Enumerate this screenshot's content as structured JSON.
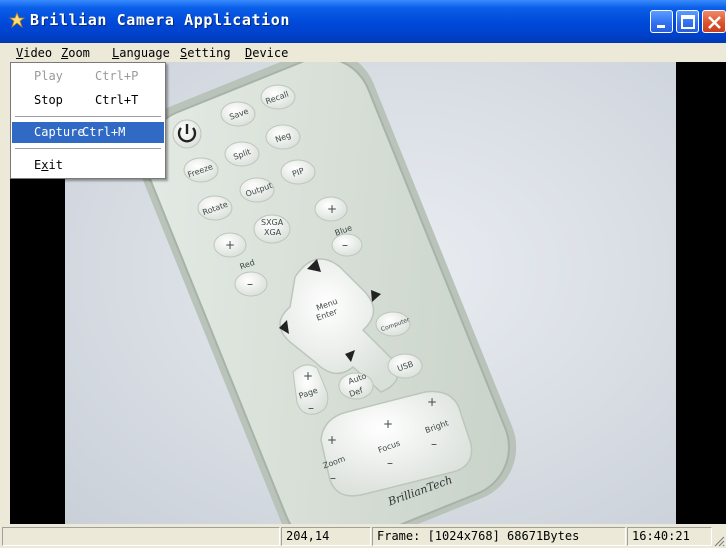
{
  "window": {
    "title": "Brillian Camera Application",
    "icon": "app-icon",
    "controls": {
      "minimize": "minimize-icon",
      "maximize": "maximize-icon",
      "close": "close-icon"
    }
  },
  "menubar": {
    "items": [
      {
        "mnemonic": "V",
        "rest": "ideo"
      },
      {
        "mnemonic": "Z",
        "rest": "oom"
      },
      {
        "mnemonic": "L",
        "rest": "anguage"
      },
      {
        "mnemonic": "S",
        "rest": "etting"
      },
      {
        "mnemonic": "D",
        "rest": "evice"
      }
    ]
  },
  "video_menu": {
    "items": [
      {
        "label": "Play",
        "shortcut": "Ctrl+P",
        "state": "disabled"
      },
      {
        "label": "Stop",
        "shortcut": "Ctrl+T",
        "state": "normal"
      },
      {
        "label": "Capture",
        "shortcut": "Ctrl+M",
        "state": "highlighted"
      },
      {
        "label_pre": "E",
        "label_mn": "x",
        "label_post": "it",
        "state": "normal"
      }
    ]
  },
  "remote": {
    "buttons": {
      "save": "Save",
      "recall": "Recall",
      "freeze": "Freeze",
      "split": "Split",
      "neg": "Neg",
      "rotate": "Rotate",
      "output": "Output",
      "pip": "PIP",
      "sxga": "SXGA",
      "xga": "XGA",
      "blue": "Blue",
      "red": "Red",
      "menu": "Menu",
      "enter": "Enter",
      "computer": "Computer",
      "page": "Page",
      "auto": "Auto",
      "def": "Def",
      "usb": "USB",
      "bright": "Bright",
      "focus": "Focus",
      "zoom": "Zoom",
      "brand": "BrillianTech"
    }
  },
  "statusbar": {
    "pane1": "",
    "coords": "204,14",
    "frame": "Frame: [1024x768] 68671Bytes",
    "time": "16:40:21"
  }
}
